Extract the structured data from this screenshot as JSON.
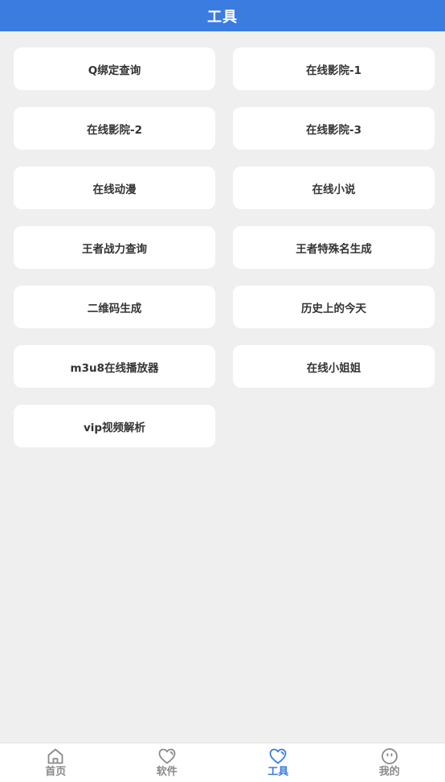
{
  "header": {
    "title": "工具"
  },
  "tools": [
    {
      "label": "Q绑定查询"
    },
    {
      "label": "在线影院-1"
    },
    {
      "label": "在线影院-2"
    },
    {
      "label": "在线影院-3"
    },
    {
      "label": "在线动漫"
    },
    {
      "label": "在线小说"
    },
    {
      "label": "王者战力查询"
    },
    {
      "label": "王者特殊名生成"
    },
    {
      "label": "二维码生成"
    },
    {
      "label": "历史上的今天"
    },
    {
      "label": "m3u8在线播放器"
    },
    {
      "label": "在线小姐姐"
    },
    {
      "label": "vip视频解析"
    }
  ],
  "tabbar": {
    "active": "工具",
    "active_color": "#3b7ce0",
    "inactive_color": "#8a8a8a",
    "items": [
      {
        "label": "首页",
        "icon": "home-icon"
      },
      {
        "label": "软件",
        "icon": "heart-icon"
      },
      {
        "label": "工具",
        "icon": "heart-icon"
      },
      {
        "label": "我的",
        "icon": "face-icon"
      }
    ]
  }
}
